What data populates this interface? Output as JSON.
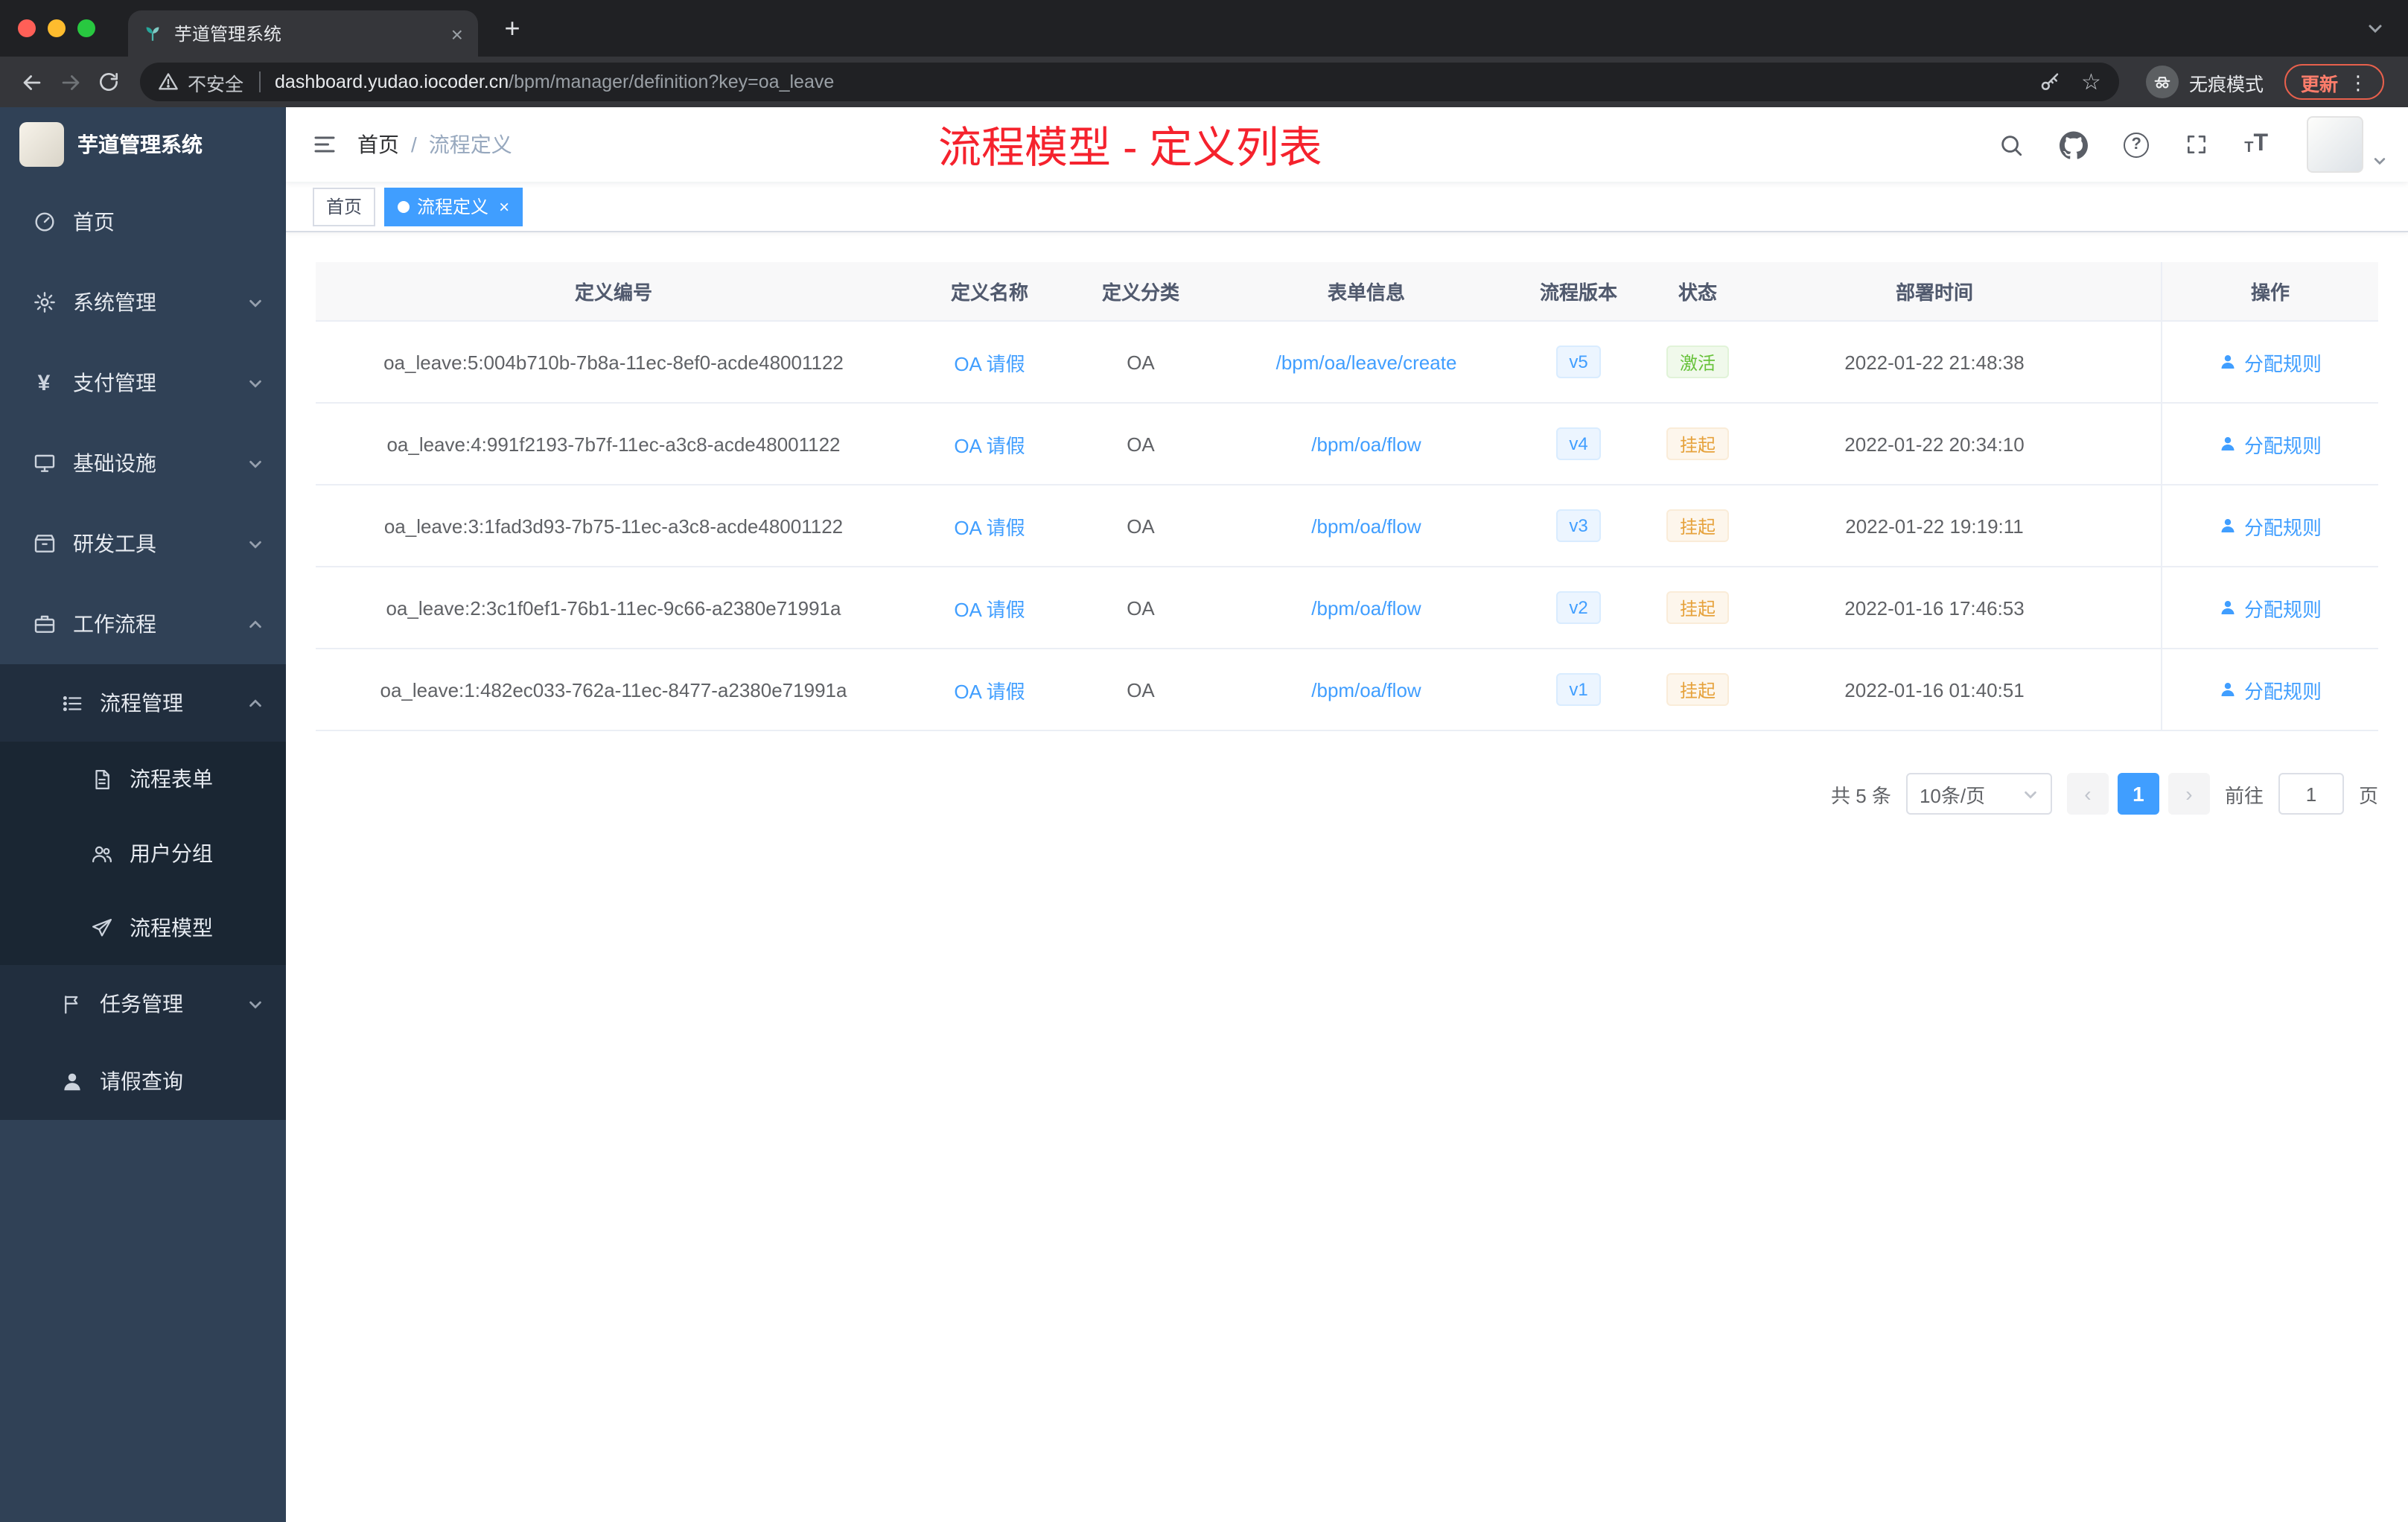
{
  "glyphs": {
    "close": "×",
    "plus": "+",
    "star": "☆",
    "question": "?",
    "kebab": "⋮",
    "prev": "‹",
    "next": "›",
    "font_small": "T",
    "font_large": "T"
  },
  "browser": {
    "tab_title": "芋道管理系统",
    "security_label": "不安全",
    "url_host": "dashboard.yudao.iocoder.cn",
    "url_path": "/bpm/manager/definition?key=oa_leave",
    "incognito_label": "无痕模式",
    "update_label": "更新"
  },
  "sidebar": {
    "logo_title": "芋道管理系统",
    "items": [
      {
        "label": "首页"
      },
      {
        "label": "系统管理"
      },
      {
        "label": "支付管理"
      },
      {
        "label": "基础设施"
      },
      {
        "label": "研发工具"
      },
      {
        "label": "工作流程"
      },
      {
        "label": "流程管理"
      },
      {
        "label": "流程表单"
      },
      {
        "label": "用户分组"
      },
      {
        "label": "流程模型"
      },
      {
        "label": "任务管理"
      },
      {
        "label": "请假查询"
      }
    ]
  },
  "header": {
    "breadcrumb": [
      "首页",
      "流程定义"
    ],
    "separator": "/",
    "overlay_title": "流程模型 - 定义列表"
  },
  "tags": [
    {
      "label": "首页"
    },
    {
      "label": "流程定义"
    }
  ],
  "table": {
    "headers": [
      "定义编号",
      "定义名称",
      "定义分类",
      "表单信息",
      "流程版本",
      "状态",
      "部署时间",
      "操作"
    ],
    "rows": [
      {
        "id": "oa_leave:5:004b710b-7b8a-11ec-8ef0-acde48001122",
        "name": "OA 请假",
        "category": "OA",
        "form": "/bpm/oa/leave/create",
        "version": "v5",
        "status": "激活",
        "status_type": "success",
        "time": "2022-01-22 21:48:38",
        "action": "分配规则"
      },
      {
        "id": "oa_leave:4:991f2193-7b7f-11ec-a3c8-acde48001122",
        "name": "OA 请假",
        "category": "OA",
        "form": "/bpm/oa/flow",
        "version": "v4",
        "status": "挂起",
        "status_type": "warning",
        "time": "2022-01-22 20:34:10",
        "action": "分配规则"
      },
      {
        "id": "oa_leave:3:1fad3d93-7b75-11ec-a3c8-acde48001122",
        "name": "OA 请假",
        "category": "OA",
        "form": "/bpm/oa/flow",
        "version": "v3",
        "status": "挂起",
        "status_type": "warning",
        "time": "2022-01-22 19:19:11",
        "action": "分配规则"
      },
      {
        "id": "oa_leave:2:3c1f0ef1-76b1-11ec-9c66-a2380e71991a",
        "name": "OA 请假",
        "category": "OA",
        "form": "/bpm/oa/flow",
        "version": "v2",
        "status": "挂起",
        "status_type": "warning",
        "time": "2022-01-16 17:46:53",
        "action": "分配规则"
      },
      {
        "id": "oa_leave:1:482ec033-762a-11ec-8477-a2380e71991a",
        "name": "OA 请假",
        "category": "OA",
        "form": "/bpm/oa/flow",
        "version": "v1",
        "status": "挂起",
        "status_type": "warning",
        "time": "2022-01-16 01:40:51",
        "action": "分配规则"
      }
    ]
  },
  "pagination": {
    "total": "共 5 条",
    "page_size": "10条/页",
    "current_page": "1",
    "goto_label": "前往",
    "goto_value": "1",
    "page_unit": "页"
  },
  "colors": {
    "accent_blue": "#409eff",
    "success_green": "#67c23a",
    "warning_orange": "#e6a23c",
    "overlay_red": "#f5222d",
    "sidebar_bg": "#304156",
    "submenu_bg": "#1f2d3d"
  }
}
